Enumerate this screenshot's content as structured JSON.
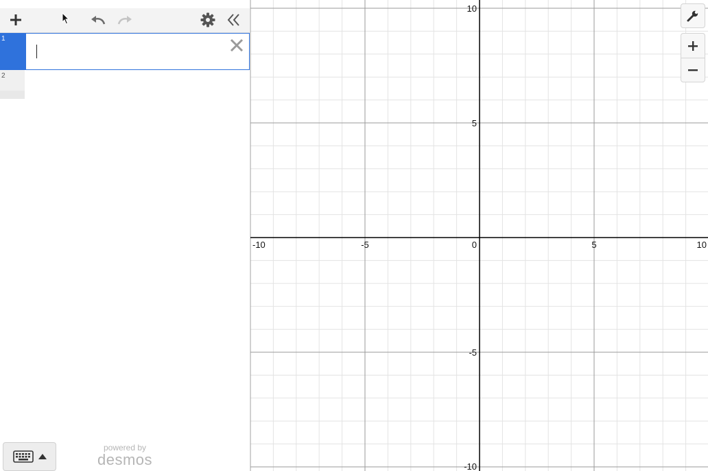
{
  "toolbar": {
    "add_icon": "plus-icon",
    "undo_icon": "undo-icon",
    "redo_icon": "redo-icon",
    "settings_icon": "gear-icon",
    "collapse_icon": "double-chevron-left-icon"
  },
  "expressions": [
    {
      "index": "1",
      "value": "",
      "active": true
    },
    {
      "index": "2",
      "value": "",
      "active": false
    }
  ],
  "footer": {
    "keyboard_icon": "keyboard-icon",
    "powered_by": "powered by",
    "brand": "desmos"
  },
  "graph": {
    "x_ticks": [
      "-10",
      "-5",
      "0",
      "5",
      "10"
    ],
    "y_ticks": [
      "10",
      "5",
      "-5",
      "-10"
    ],
    "axis_color": "#000000",
    "major_grid_color": "#9a9a9a",
    "minor_grid_color": "#e3e3e3"
  },
  "controls": {
    "wrench_icon": "wrench-icon",
    "zoom_in_icon": "plus-icon",
    "zoom_out_icon": "minus-icon"
  },
  "colors": {
    "accent": "#2f72dc"
  }
}
